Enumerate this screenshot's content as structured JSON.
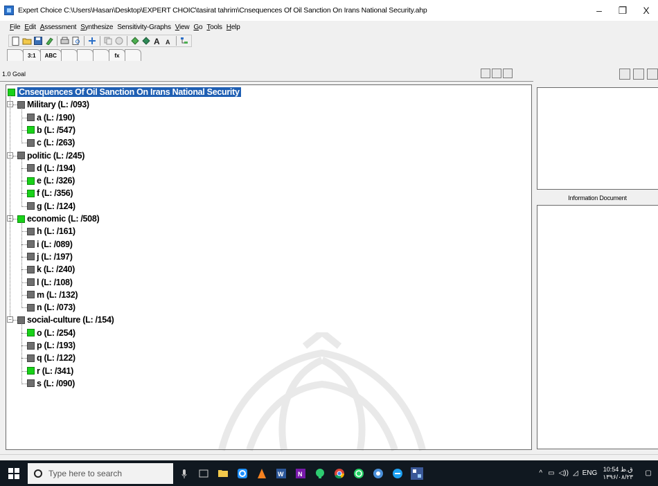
{
  "window": {
    "title": "Expert Choice   C:\\Users\\Hasan\\Desktop\\EXPERT CHOIC\\tasirat tahrim\\Cnsequences Of Oil Sanction On Irans National Security.ahp",
    "minimize": "–",
    "maximize": "❐",
    "close": "X"
  },
  "menu": [
    {
      "u": "F",
      "rest": "ile"
    },
    {
      "u": "E",
      "rest": "dit"
    },
    {
      "u": "A",
      "rest": "ssessment"
    },
    {
      "u": "S",
      "rest": "ynthesize"
    },
    {
      "u": "",
      "rest": "Sensitivity-Graphs"
    },
    {
      "u": "V",
      "rest": "iew"
    },
    {
      "u": "G",
      "rest": "o"
    },
    {
      "u": "T",
      "rest": "ools"
    },
    {
      "u": "H",
      "rest": "elp"
    }
  ],
  "tabs": [
    "",
    "3:1",
    "ABC",
    "",
    "",
    "",
    "fx",
    ""
  ],
  "goal_bar": {
    "label": "1.0 Goal"
  },
  "tree": {
    "goal": "Cnsequences Of Oil Sanction On Irans National Security",
    "criteria": [
      {
        "label": "Military (L: /093)",
        "children": [
          "a (L: /190)",
          "b (L: /547)",
          "c (L: /263)"
        ]
      },
      {
        "label": "politic (L: /245)",
        "children": [
          "d (L: /194)",
          "e (L: /326)",
          "f (L: /356)",
          "g (L: /124)"
        ]
      },
      {
        "label": "economic (L: /508)",
        "children": [
          "h (L: /161)",
          "i (L: /089)",
          "j (L: /197)",
          "k (L: /240)",
          "l (L: /108)",
          "m (L: /132)",
          "n (L: /073)"
        ]
      },
      {
        "label": "social-culture (L: /154)",
        "children": [
          "o (L: /254)",
          "p (L: /193)",
          "q (L: /122)",
          "r (L: /341)",
          "s (L: /090)"
        ]
      }
    ]
  },
  "right_pane": {
    "info_label": "Information Document"
  },
  "taskbar": {
    "search_placeholder": "Type here to search",
    "lang": "ENG",
    "time": "10:54 ق.ظ",
    "date": "۱۳۹۶/۰۸/۲۳"
  },
  "colors": {
    "selected": "#1f5fb3",
    "green_node": "#19d219",
    "gray_node": "#6e6e6e"
  }
}
